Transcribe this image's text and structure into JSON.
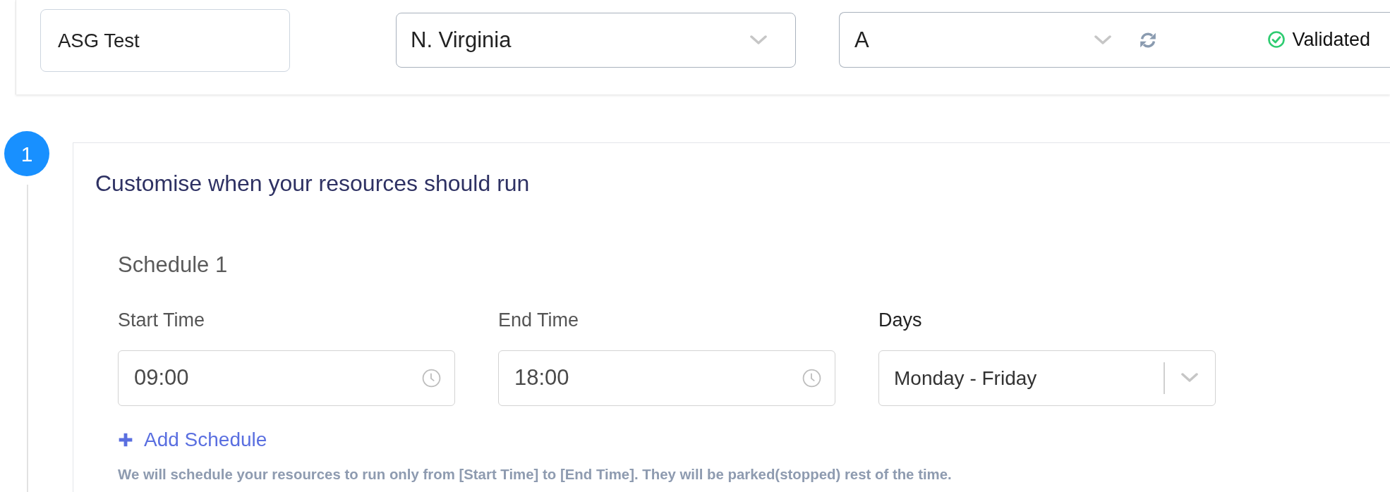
{
  "top_bar": {
    "name_field": {
      "value": "ASG Test"
    },
    "region_select": {
      "value": "N. Virginia"
    },
    "account_select": {
      "value": "A",
      "status": "Validated"
    }
  },
  "step": {
    "number": "1",
    "title": "Customise when your resources should run",
    "schedules": [
      {
        "title": "Schedule 1",
        "fields": [
          {
            "kind": "time",
            "label": "Start Time",
            "value": "09:00"
          },
          {
            "kind": "time",
            "label": "End Time",
            "value": "18:00"
          },
          {
            "kind": "select",
            "label": "Days",
            "value": "Monday - Friday"
          }
        ]
      }
    ],
    "add_button": {
      "label": "Add Schedule"
    },
    "help_text": "We will schedule your resources to run only from [Start Time] to [End Time]. They will be parked(stopped) rest of the time."
  }
}
